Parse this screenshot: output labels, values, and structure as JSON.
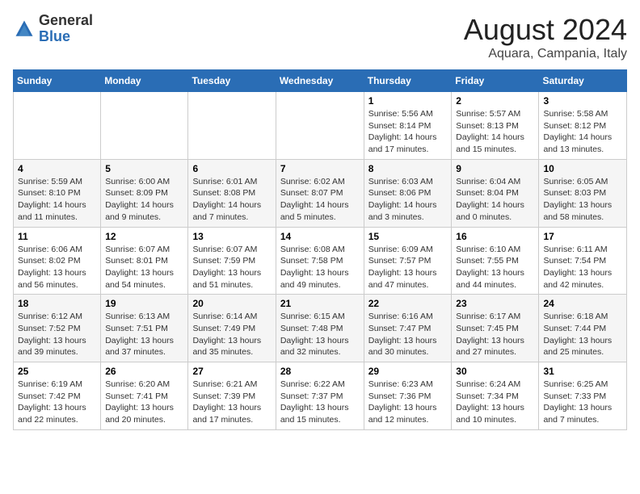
{
  "logo": {
    "general": "General",
    "blue": "Blue"
  },
  "title": "August 2024",
  "location": "Aquara, Campania, Italy",
  "days_of_week": [
    "Sunday",
    "Monday",
    "Tuesday",
    "Wednesday",
    "Thursday",
    "Friday",
    "Saturday"
  ],
  "weeks": [
    [
      {
        "day": "",
        "info": ""
      },
      {
        "day": "",
        "info": ""
      },
      {
        "day": "",
        "info": ""
      },
      {
        "day": "",
        "info": ""
      },
      {
        "day": "1",
        "info": "Sunrise: 5:56 AM\nSunset: 8:14 PM\nDaylight: 14 hours\nand 17 minutes."
      },
      {
        "day": "2",
        "info": "Sunrise: 5:57 AM\nSunset: 8:13 PM\nDaylight: 14 hours\nand 15 minutes."
      },
      {
        "day": "3",
        "info": "Sunrise: 5:58 AM\nSunset: 8:12 PM\nDaylight: 14 hours\nand 13 minutes."
      }
    ],
    [
      {
        "day": "4",
        "info": "Sunrise: 5:59 AM\nSunset: 8:10 PM\nDaylight: 14 hours\nand 11 minutes."
      },
      {
        "day": "5",
        "info": "Sunrise: 6:00 AM\nSunset: 8:09 PM\nDaylight: 14 hours\nand 9 minutes."
      },
      {
        "day": "6",
        "info": "Sunrise: 6:01 AM\nSunset: 8:08 PM\nDaylight: 14 hours\nand 7 minutes."
      },
      {
        "day": "7",
        "info": "Sunrise: 6:02 AM\nSunset: 8:07 PM\nDaylight: 14 hours\nand 5 minutes."
      },
      {
        "day": "8",
        "info": "Sunrise: 6:03 AM\nSunset: 8:06 PM\nDaylight: 14 hours\nand 3 minutes."
      },
      {
        "day": "9",
        "info": "Sunrise: 6:04 AM\nSunset: 8:04 PM\nDaylight: 14 hours\nand 0 minutes."
      },
      {
        "day": "10",
        "info": "Sunrise: 6:05 AM\nSunset: 8:03 PM\nDaylight: 13 hours\nand 58 minutes."
      }
    ],
    [
      {
        "day": "11",
        "info": "Sunrise: 6:06 AM\nSunset: 8:02 PM\nDaylight: 13 hours\nand 56 minutes."
      },
      {
        "day": "12",
        "info": "Sunrise: 6:07 AM\nSunset: 8:01 PM\nDaylight: 13 hours\nand 54 minutes."
      },
      {
        "day": "13",
        "info": "Sunrise: 6:07 AM\nSunset: 7:59 PM\nDaylight: 13 hours\nand 51 minutes."
      },
      {
        "day": "14",
        "info": "Sunrise: 6:08 AM\nSunset: 7:58 PM\nDaylight: 13 hours\nand 49 minutes."
      },
      {
        "day": "15",
        "info": "Sunrise: 6:09 AM\nSunset: 7:57 PM\nDaylight: 13 hours\nand 47 minutes."
      },
      {
        "day": "16",
        "info": "Sunrise: 6:10 AM\nSunset: 7:55 PM\nDaylight: 13 hours\nand 44 minutes."
      },
      {
        "day": "17",
        "info": "Sunrise: 6:11 AM\nSunset: 7:54 PM\nDaylight: 13 hours\nand 42 minutes."
      }
    ],
    [
      {
        "day": "18",
        "info": "Sunrise: 6:12 AM\nSunset: 7:52 PM\nDaylight: 13 hours\nand 39 minutes."
      },
      {
        "day": "19",
        "info": "Sunrise: 6:13 AM\nSunset: 7:51 PM\nDaylight: 13 hours\nand 37 minutes."
      },
      {
        "day": "20",
        "info": "Sunrise: 6:14 AM\nSunset: 7:49 PM\nDaylight: 13 hours\nand 35 minutes."
      },
      {
        "day": "21",
        "info": "Sunrise: 6:15 AM\nSunset: 7:48 PM\nDaylight: 13 hours\nand 32 minutes."
      },
      {
        "day": "22",
        "info": "Sunrise: 6:16 AM\nSunset: 7:47 PM\nDaylight: 13 hours\nand 30 minutes."
      },
      {
        "day": "23",
        "info": "Sunrise: 6:17 AM\nSunset: 7:45 PM\nDaylight: 13 hours\nand 27 minutes."
      },
      {
        "day": "24",
        "info": "Sunrise: 6:18 AM\nSunset: 7:44 PM\nDaylight: 13 hours\nand 25 minutes."
      }
    ],
    [
      {
        "day": "25",
        "info": "Sunrise: 6:19 AM\nSunset: 7:42 PM\nDaylight: 13 hours\nand 22 minutes."
      },
      {
        "day": "26",
        "info": "Sunrise: 6:20 AM\nSunset: 7:41 PM\nDaylight: 13 hours\nand 20 minutes."
      },
      {
        "day": "27",
        "info": "Sunrise: 6:21 AM\nSunset: 7:39 PM\nDaylight: 13 hours\nand 17 minutes."
      },
      {
        "day": "28",
        "info": "Sunrise: 6:22 AM\nSunset: 7:37 PM\nDaylight: 13 hours\nand 15 minutes."
      },
      {
        "day": "29",
        "info": "Sunrise: 6:23 AM\nSunset: 7:36 PM\nDaylight: 13 hours\nand 12 minutes."
      },
      {
        "day": "30",
        "info": "Sunrise: 6:24 AM\nSunset: 7:34 PM\nDaylight: 13 hours\nand 10 minutes."
      },
      {
        "day": "31",
        "info": "Sunrise: 6:25 AM\nSunset: 7:33 PM\nDaylight: 13 hours\nand 7 minutes."
      }
    ]
  ]
}
